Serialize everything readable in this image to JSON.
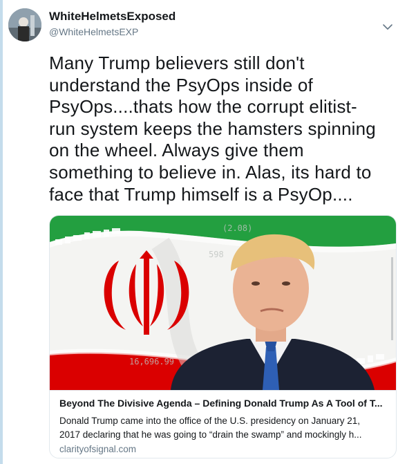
{
  "user": {
    "display_name": "WhiteHelmetsExposed",
    "handle": "@WhiteHelmetsEXP"
  },
  "tweet": {
    "lines": [
      "Many Trump believers still don't",
      "understand the PsyOps inside of",
      "PsyOps....thats how the corrupt elitist-",
      "run system keeps the hamsters spinning",
      "on the wheel. Always give them",
      "something to believe in. Alas, its hard to",
      "face that Trump himself is a PsyOp...."
    ]
  },
  "card": {
    "title": "Beyond The Divisive Agenda – Defining Donald Trump As A Tool of T...",
    "description_lines": [
      "Donald Trump came into the office of the U.S. presidency on January 21,",
      "2017 declaring that he was going to “drain the swamp” and mockingly h..."
    ],
    "domain": "clarityofsignal.com",
    "image_alt": "Donald Trump in front of the flag of Iran"
  },
  "icons": {
    "more_menu": "chevron-down-icon"
  },
  "colors": {
    "thread_line": "#c4dcec",
    "secondary_text": "#657786",
    "border": "#e1e8ed",
    "flag_green": "#239f40",
    "flag_red": "#da0000"
  }
}
